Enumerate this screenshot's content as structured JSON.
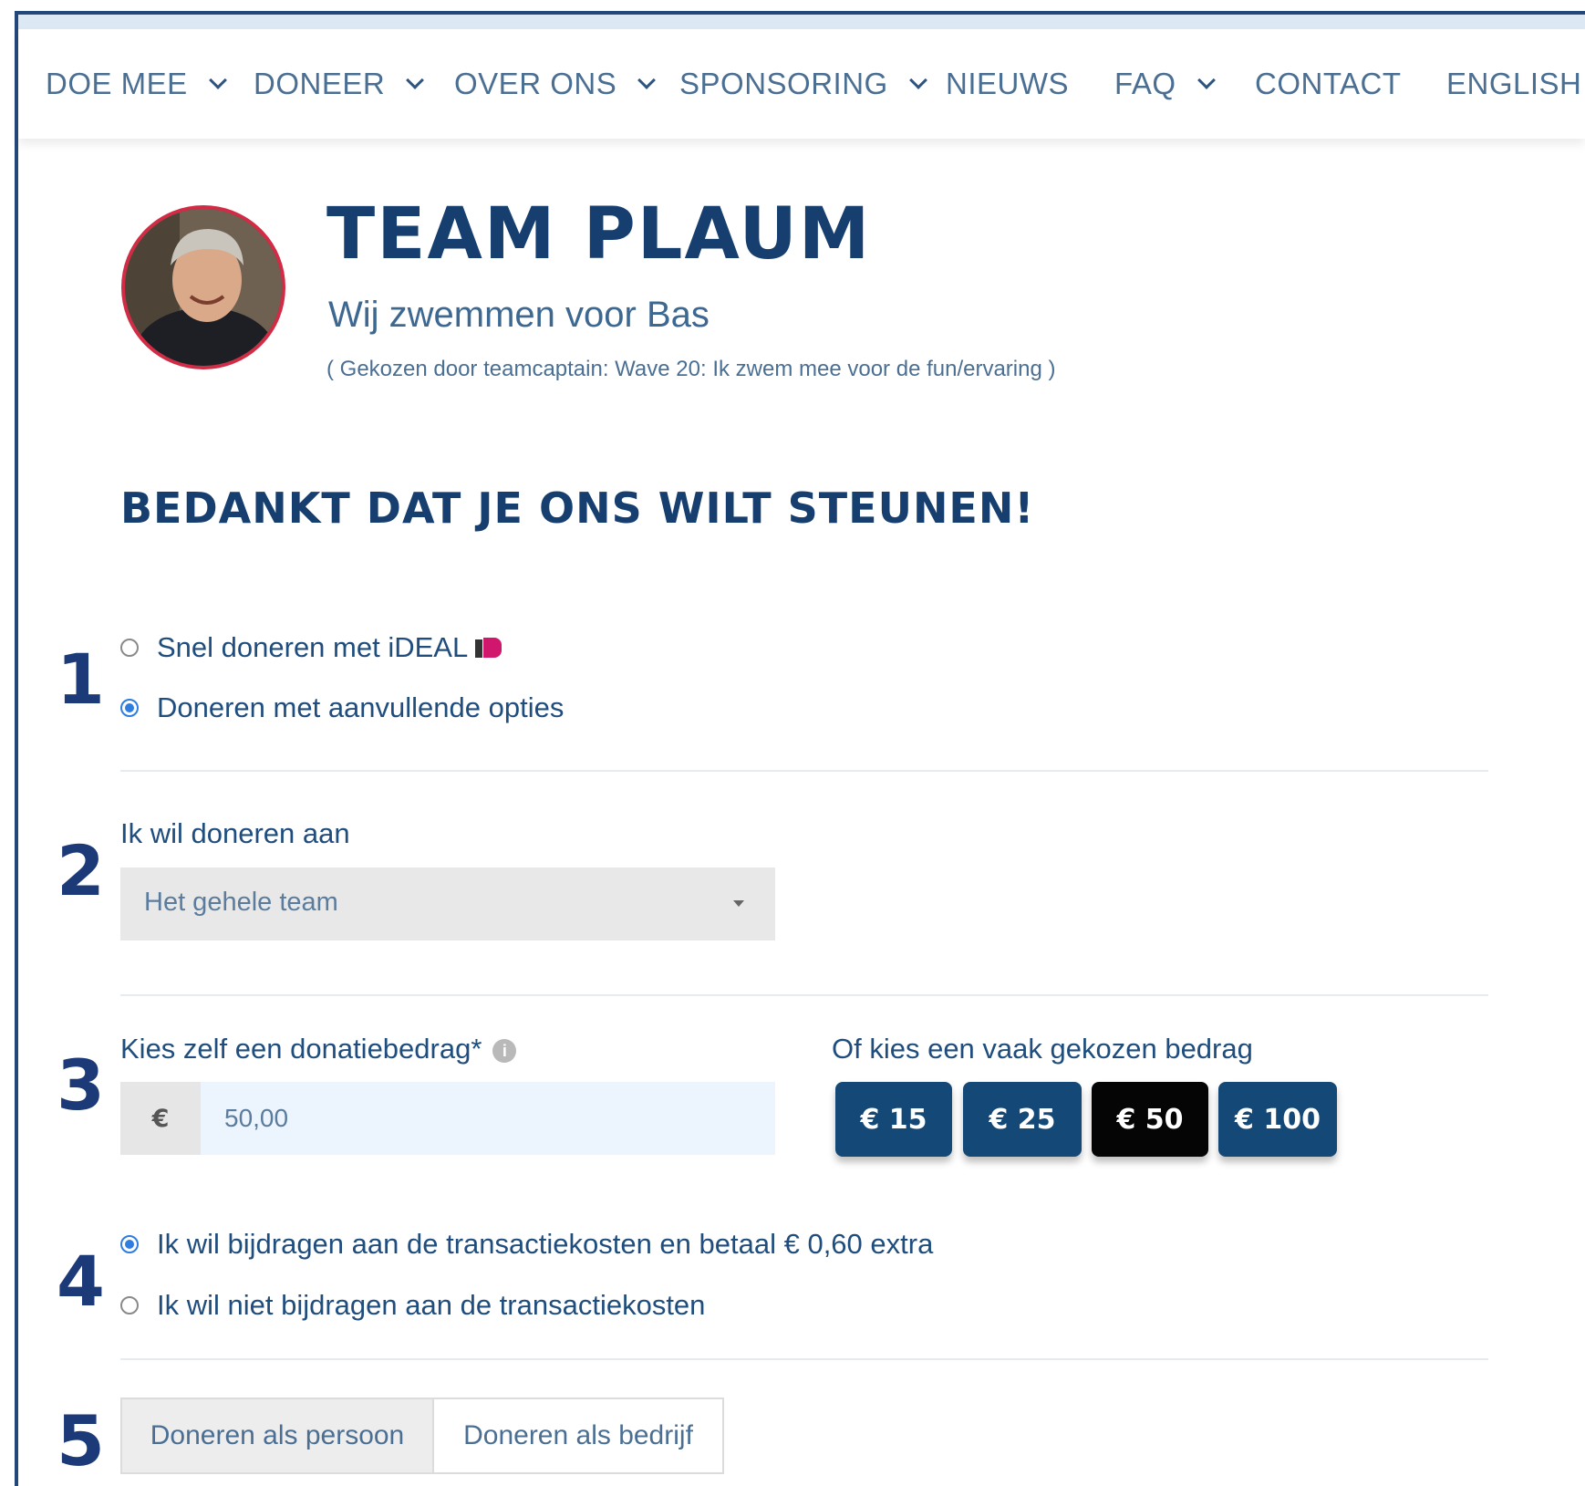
{
  "nav": {
    "items": [
      {
        "label": "DOE MEE",
        "has_dropdown": true
      },
      {
        "label": "DONEER",
        "has_dropdown": true
      },
      {
        "label": "OVER ONS",
        "has_dropdown": true
      },
      {
        "label": "SPONSORING",
        "has_dropdown": true
      },
      {
        "label": "NIEUWS",
        "has_dropdown": false
      },
      {
        "label": "FAQ",
        "has_dropdown": true
      },
      {
        "label": "CONTACT",
        "has_dropdown": false
      },
      {
        "label": "ENGLISH",
        "has_dropdown": false
      }
    ]
  },
  "team": {
    "name": "TEAM PLAUM",
    "subtitle": "Wij zwemmen voor Bas",
    "note": "( Gekozen door teamcaptain: Wave 20: Ik zwem mee voor de fun/ervaring )"
  },
  "heading": "BEDANKT DAT JE ONS WILT STEUNEN!",
  "steps": {
    "s1": "1",
    "s2": "2",
    "s3": "3",
    "s4": "4",
    "s5": "5"
  },
  "donation_type": {
    "options": [
      {
        "label": "Snel doneren met iDEAL",
        "selected": false
      },
      {
        "label": "Doneren met aanvullende opties",
        "selected": true
      }
    ]
  },
  "recipient": {
    "label": "Ik wil doneren aan",
    "selected": "Het gehele team"
  },
  "amount": {
    "label": "Kies zelf een donatiebedrag*",
    "currency": "€",
    "value": "50,00",
    "quick_label": "Of kies een vaak gekozen bedrag",
    "quick_options": [
      "€ 15",
      "€ 25",
      "€ 50",
      "€ 100"
    ],
    "active_quick": "€ 50"
  },
  "fees": {
    "options": [
      {
        "label": "Ik wil bijdragen aan de transactiekosten en betaal € 0,60 extra",
        "selected": true
      },
      {
        "label": "Ik wil niet bijdragen aan de transactiekosten",
        "selected": false
      }
    ]
  },
  "donor_type": {
    "tabs": [
      "Doneren als persoon",
      "Doneren als bedrijf"
    ],
    "active": "Doneren als persoon"
  },
  "colors": {
    "primary": "#134877",
    "heading": "#163f6f",
    "active_pill": "#050505",
    "avatar_border": "#d22b45",
    "radio_on": "#2f7de1"
  }
}
